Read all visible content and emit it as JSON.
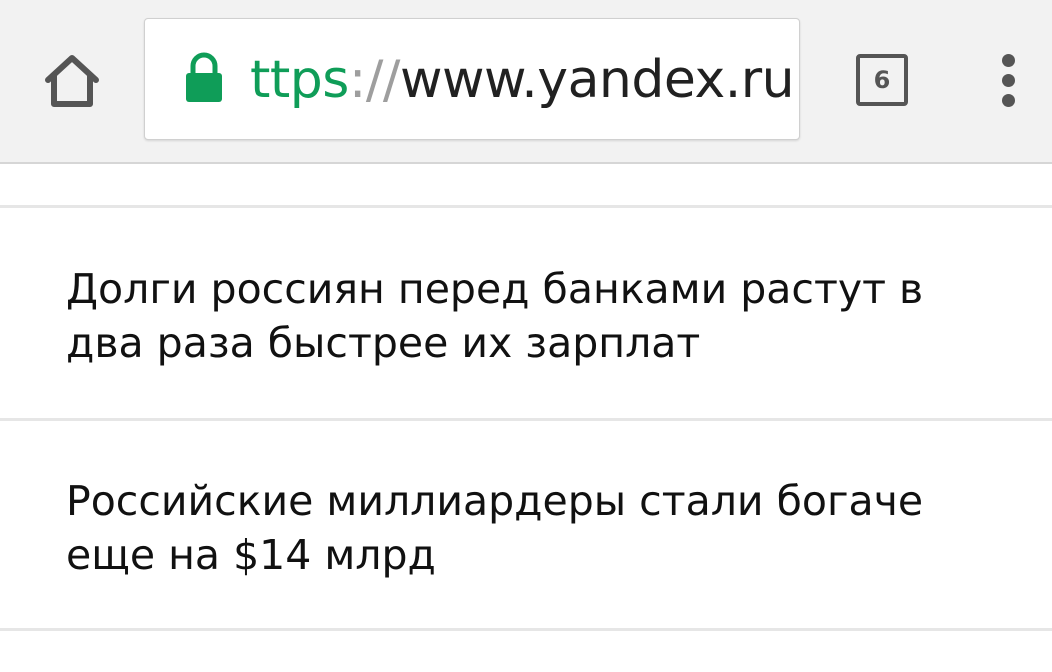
{
  "browser": {
    "url": {
      "scheme_visible": "ttps",
      "separator": "://",
      "host": "www.yandex.ru"
    },
    "tab_count": "6",
    "icons": {
      "home": "home-icon",
      "lock": "lock-icon",
      "tabs": "tabs-icon",
      "menu": "overflow-menu-icon"
    },
    "colors": {
      "secure_green": "#0f9d58",
      "toolbar_bg": "#f2f2f2",
      "icon_gray": "#555555"
    }
  },
  "news": [
    {
      "lines": [
        "Долги россиян перед банками растут в",
        "два раза быстрее их зарплат"
      ]
    },
    {
      "lines": [
        "Российские миллиардеры стали богаче",
        "еще на $14 млрд"
      ]
    }
  ]
}
